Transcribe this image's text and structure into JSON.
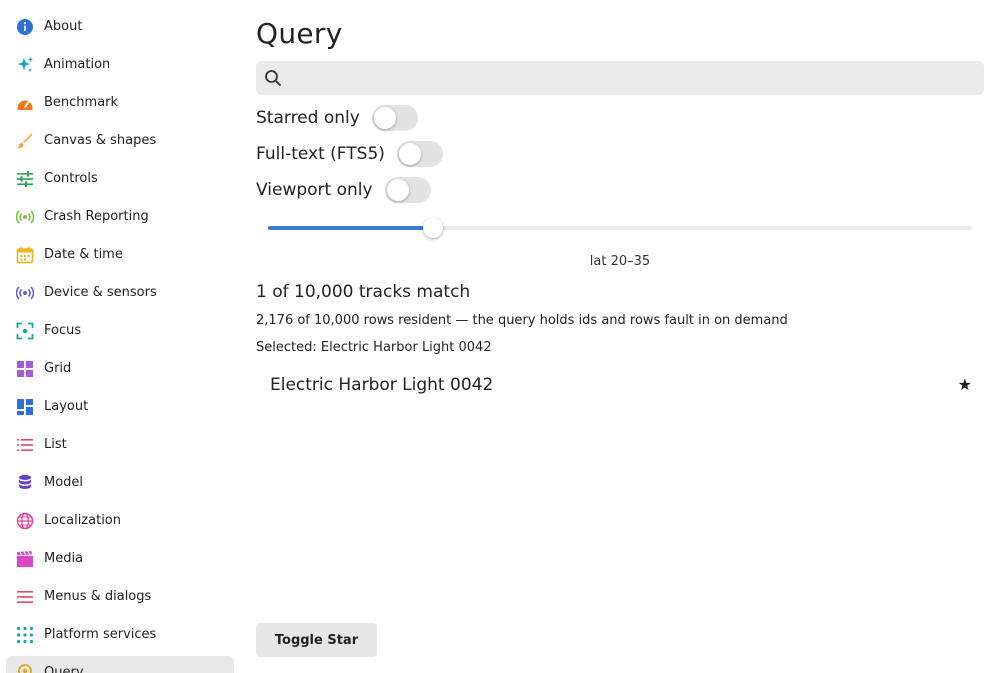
{
  "sidebar": {
    "items": [
      {
        "label": "About",
        "icon": "info-icon",
        "color": "#2f6fdb"
      },
      {
        "label": "Animation",
        "icon": "sparkle-icon",
        "color": "#11a7c4"
      },
      {
        "label": "Benchmark",
        "icon": "speedometer-icon",
        "color": "#f07a1a"
      },
      {
        "label": "Canvas & shapes",
        "icon": "brush-icon",
        "color": "#f0a030"
      },
      {
        "label": "Controls",
        "icon": "sliders-icon",
        "color": "#2aa35a"
      },
      {
        "label": "Crash Reporting",
        "icon": "signal-icon",
        "color": "#7ac143"
      },
      {
        "label": "Date & time",
        "icon": "calendar-icon",
        "color": "#e8b416"
      },
      {
        "label": "Device & sensors",
        "icon": "broadcast-icon",
        "color": "#5b63c9"
      },
      {
        "label": "Focus",
        "icon": "focus-icon",
        "color": "#16a7a0"
      },
      {
        "label": "Grid",
        "icon": "grid-icon",
        "color": "#a35bd8"
      },
      {
        "label": "Layout",
        "icon": "layout-icon",
        "color": "#2f6fdb"
      },
      {
        "label": "List",
        "icon": "list-icon",
        "color": "#e0486a"
      },
      {
        "label": "Model",
        "icon": "database-icon",
        "color": "#6b3fc9"
      },
      {
        "label": "Localization",
        "icon": "globe-icon",
        "color": "#e0459a"
      },
      {
        "label": "Media",
        "icon": "clapperboard-icon",
        "color": "#d946c9"
      },
      {
        "label": "Menus & dialogs",
        "icon": "menu-icon",
        "color": "#e0486a"
      },
      {
        "label": "Platform services",
        "icon": "dots-grid-icon",
        "color": "#16a7a0"
      },
      {
        "label": "Query",
        "icon": "location-pin-icon",
        "color": "#e8a416"
      }
    ],
    "active_index": 17
  },
  "main": {
    "title": "Query",
    "search": {
      "value": "",
      "placeholder": ""
    },
    "toggles": [
      {
        "label": "Starred only",
        "on": false
      },
      {
        "label": "Full-text (FTS5)",
        "on": false
      },
      {
        "label": "Viewport only",
        "on": false
      }
    ],
    "slider": {
      "value_fraction": 0.235,
      "caption": "lat 20–35"
    },
    "match_count": "1 of 10,000 tracks match",
    "resident": "2,176 of 10,000 rows resident — the query holds ids and rows fault in on demand",
    "selected": "Selected: Electric Harbor Light 0042",
    "results": [
      {
        "name": "Electric Harbor Light 0042",
        "starred": true,
        "star_glyph": "★"
      }
    ],
    "toggle_star_label": "Toggle Star"
  },
  "colors": {
    "accent": "#3a7ad9",
    "surface": "#ebebeb",
    "active_nav": "#e9e9e9"
  }
}
